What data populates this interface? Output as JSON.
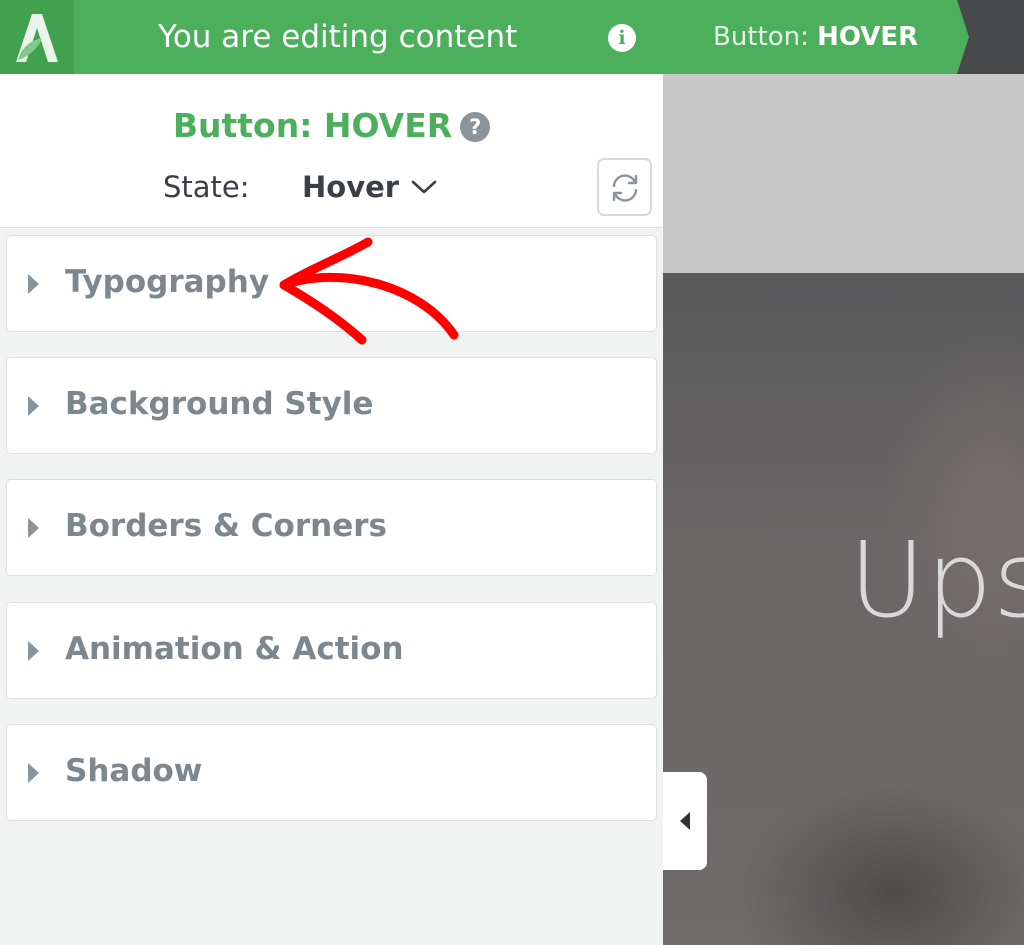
{
  "topbar": {
    "editing_text": "You are editing content",
    "breadcrumb_prefix": "Button: ",
    "breadcrumb_state": "HOVER",
    "brand_color": "#4caf5c"
  },
  "panel": {
    "title": "Button: HOVER",
    "state_label": "State:",
    "state_value": "Hover",
    "sections": [
      {
        "label": "Typography"
      },
      {
        "label": "Background Style"
      },
      {
        "label": "Borders & Corners"
      },
      {
        "label": "Animation & Action"
      },
      {
        "label": "Shadow"
      }
    ]
  },
  "preview": {
    "heading": "Ups"
  },
  "annotation": {
    "color": "#ff0000"
  },
  "icons": {
    "logo": "logo-a-leaf-icon",
    "info": "info-icon",
    "help": "question-circle-icon",
    "state_dropdown": "chevron-down-icon",
    "reset": "refresh-icon",
    "section_toggle": "caret-right-icon",
    "collapse": "caret-left-icon"
  }
}
